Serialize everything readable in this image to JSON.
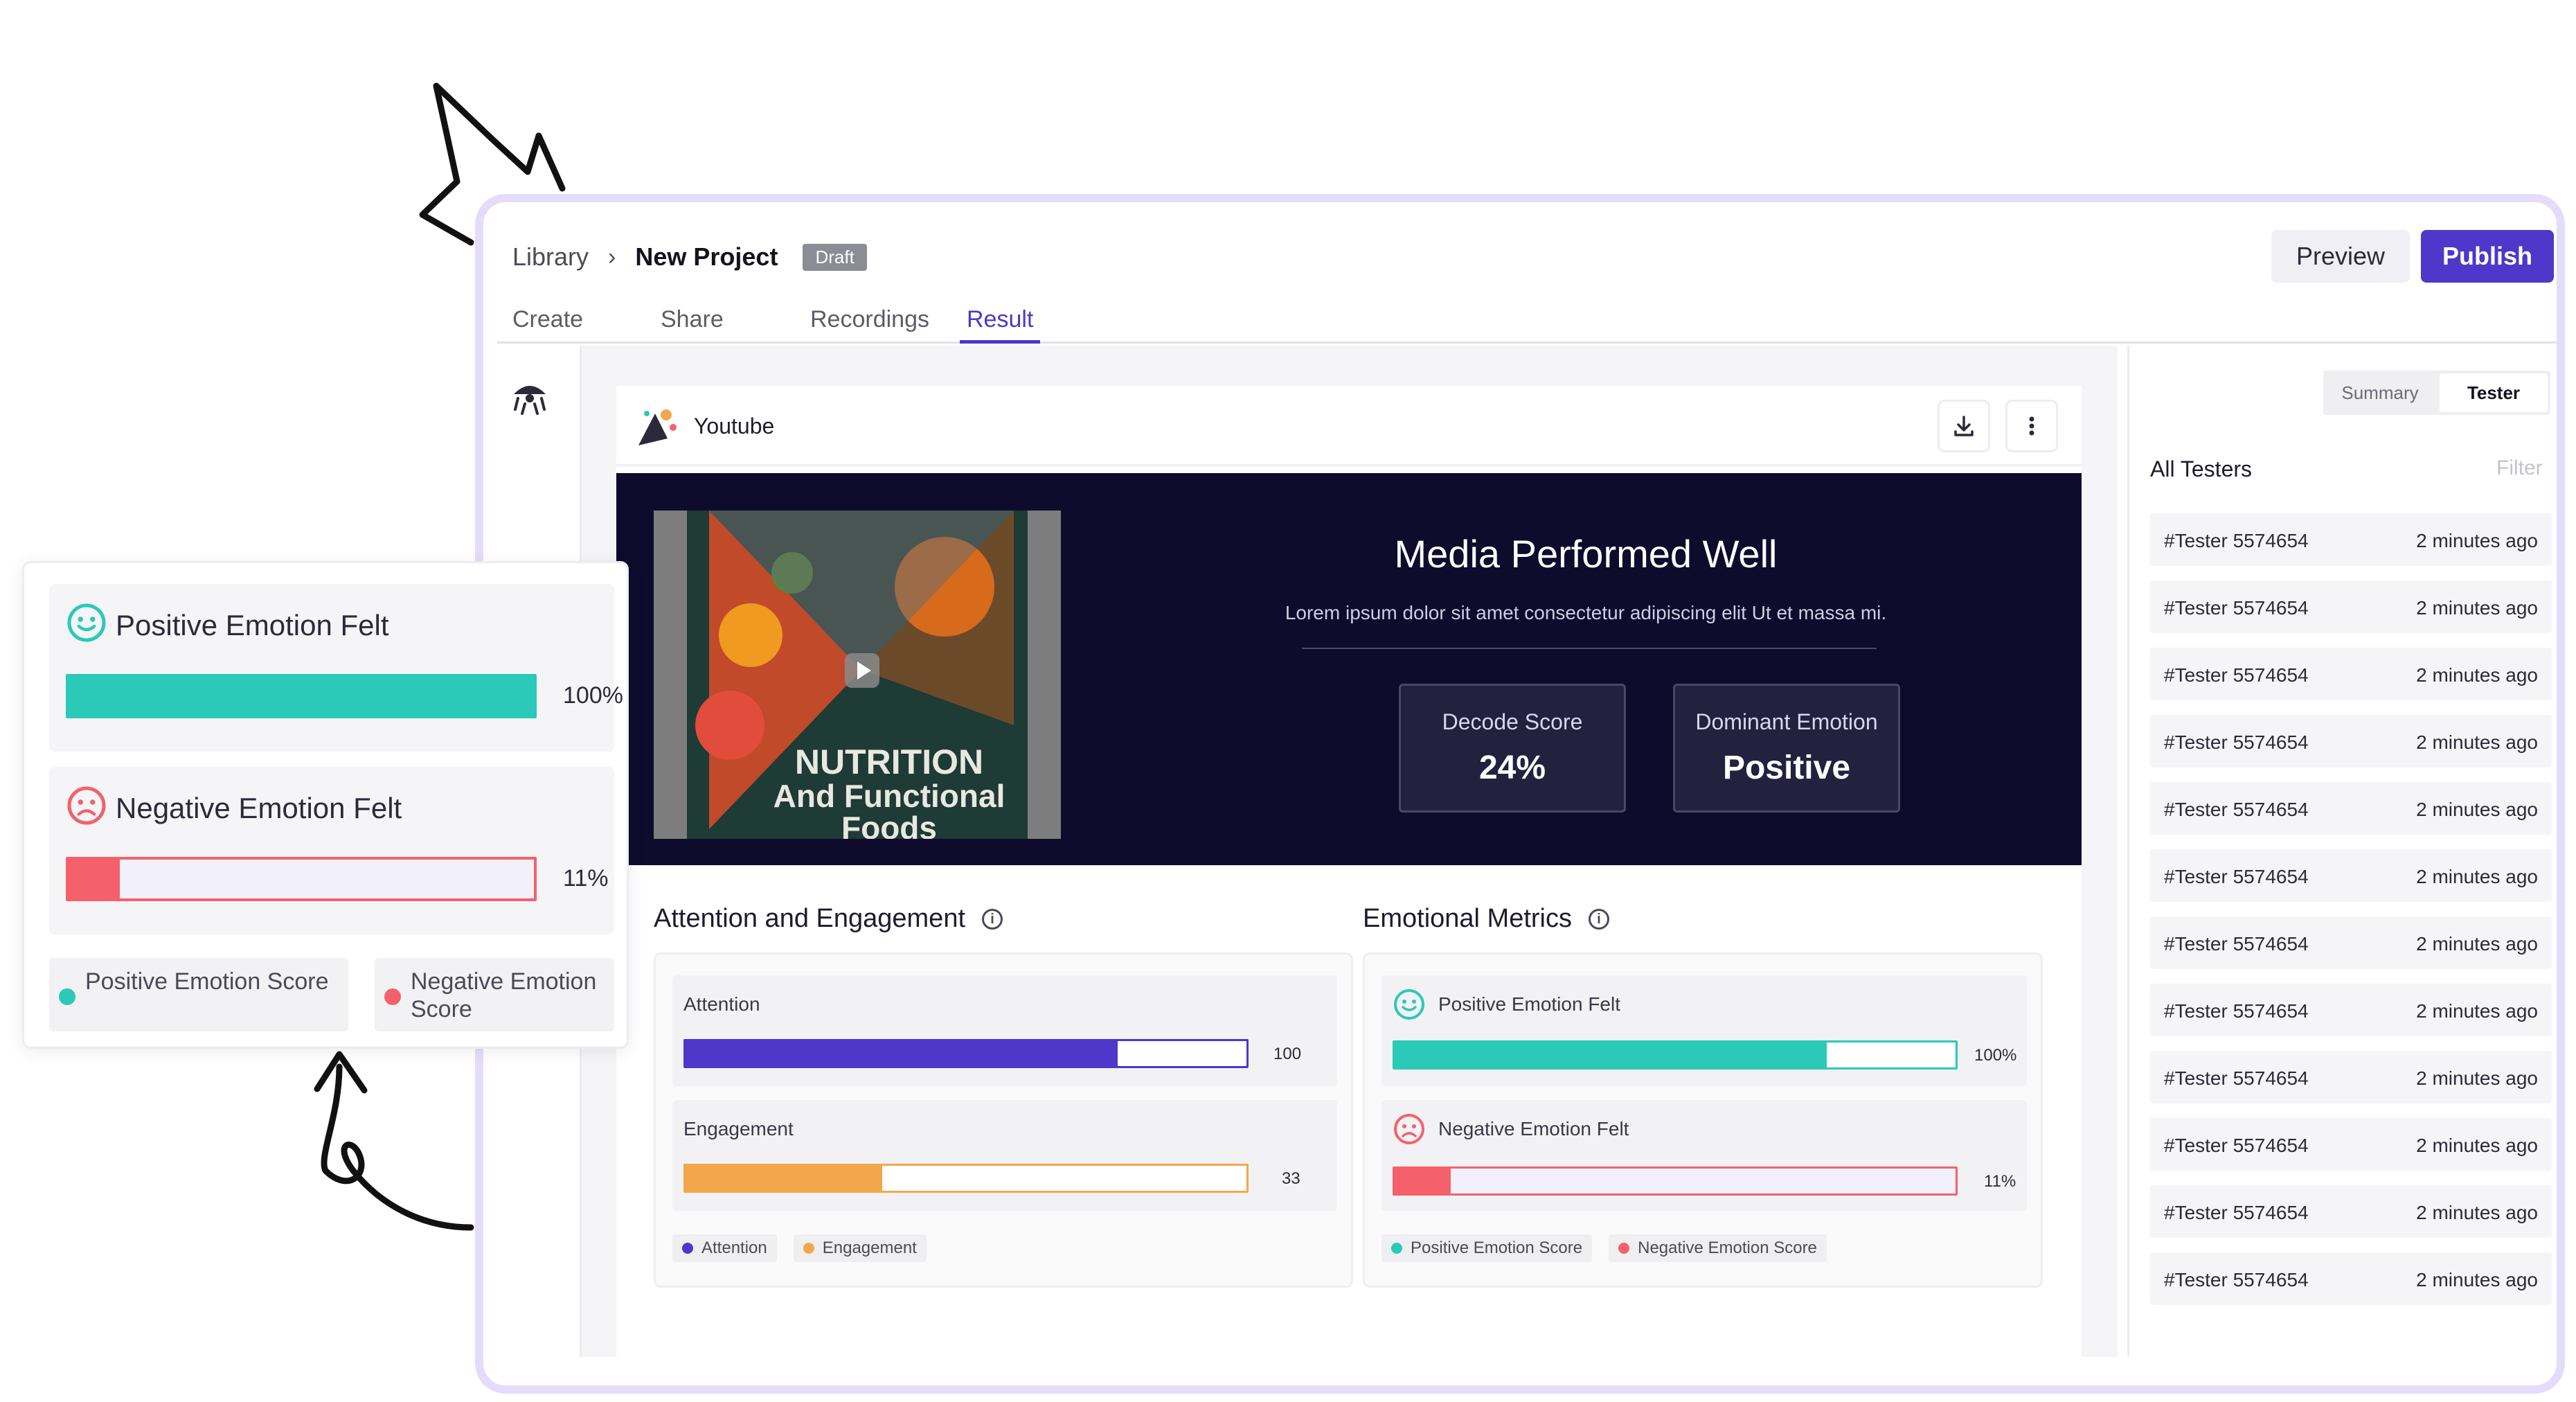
{
  "breadcrumb": {
    "root": "Library",
    "project": "New Project",
    "status": "Draft"
  },
  "actions": {
    "preview": "Preview",
    "publish": "Publish"
  },
  "tabs": [
    {
      "label": "Create"
    },
    {
      "label": "Share"
    },
    {
      "label": "Recordings"
    },
    {
      "label": "Result",
      "active": true
    }
  ],
  "media": {
    "source": "Youtube",
    "thumbnail_text_1": "NUTRITION",
    "thumbnail_text_2": "And Functional",
    "thumbnail_text_3": "Foods"
  },
  "hero": {
    "title": "Media Performed Well",
    "subtitle": "Lorem ipsum dolor sit amet consectetur adipiscing elit Ut et massa mi.",
    "decode_label": "Decode Score",
    "decode_value": "24%",
    "emotion_label": "Dominant Emotion",
    "emotion_value": "Positive"
  },
  "attention_section": {
    "title": "Attention and Engagement",
    "attention_label": "Attention",
    "attention_value": "100",
    "attention_fraction": 0.77,
    "engagement_label": "Engagement",
    "engagement_value": "33",
    "engagement_fraction": 0.35,
    "legend_attention": "Attention",
    "legend_engagement": "Engagement"
  },
  "emotion_section": {
    "title": "Emotional Metrics",
    "positive_label": "Positive Emotion Felt",
    "positive_value": "100%",
    "positive_fraction": 0.77,
    "negative_label": "Negative Emotion Felt",
    "negative_value": "11%",
    "negative_fraction": 0.1,
    "legend_positive": "Positive Emotion Score",
    "legend_negative": "Negative Emotion Score"
  },
  "right_panel": {
    "seg_summary": "Summary",
    "seg_tester": "Tester",
    "heading": "All Testers",
    "filter": "Filter",
    "testers": [
      {
        "id": "#Tester 5574654",
        "time": "2 minutes ago"
      },
      {
        "id": "#Tester 5574654",
        "time": "2 minutes ago"
      },
      {
        "id": "#Tester 5574654",
        "time": "2 minutes ago"
      },
      {
        "id": "#Tester 5574654",
        "time": "2 minutes ago"
      },
      {
        "id": "#Tester 5574654",
        "time": "2 minutes ago"
      },
      {
        "id": "#Tester 5574654",
        "time": "2 minutes ago"
      },
      {
        "id": "#Tester 5574654",
        "time": "2 minutes ago"
      },
      {
        "id": "#Tester 5574654",
        "time": "2 minutes ago"
      },
      {
        "id": "#Tester 5574654",
        "time": "2 minutes ago"
      },
      {
        "id": "#Tester 5574654",
        "time": "2 minutes ago"
      },
      {
        "id": "#Tester 5574654",
        "time": "2 minutes ago"
      },
      {
        "id": "#Tester 5574654",
        "time": "2 minutes ago"
      }
    ]
  },
  "callout": {
    "positive_label": "Positive Emotion Felt",
    "positive_value": "100%",
    "positive_fraction": 1.0,
    "negative_label": "Negative Emotion Felt",
    "negative_value": "11%",
    "negative_fraction": 0.11,
    "legend_positive": "Positive Emotion Score",
    "legend_negative": "Negative Emotion Score"
  },
  "colors": {
    "brand": "#4e37c9",
    "positive": "#2ac9b8",
    "negative": "#f4616b",
    "engagement": "#f4a64a",
    "hero_bg": "#0f0b2d"
  },
  "icons": [
    "download-icon",
    "more-vertical-icon",
    "info-icon",
    "smile-icon",
    "frown-icon",
    "play-icon",
    "chevron-right-icon"
  ]
}
